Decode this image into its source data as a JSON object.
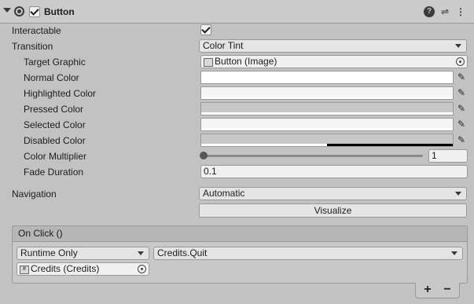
{
  "component": {
    "title": "Button",
    "enabled": true,
    "icons": {
      "help": "help-icon",
      "presets": "presets-icon",
      "menu": "more-vertical-icon",
      "component": "button-component-icon"
    }
  },
  "fields": {
    "interactable": {
      "label": "Interactable",
      "checked": true
    },
    "transition": {
      "label": "Transition",
      "value": "Color Tint"
    },
    "target_graphic": {
      "label": "Target Graphic",
      "value": "Button (Image)"
    },
    "normal_color": {
      "label": "Normal Color",
      "color": "#ffffff",
      "alpha": 1.0
    },
    "highlighted_color": {
      "label": "Highlighted Color",
      "color": "#f5f5f5",
      "alpha": 1.0
    },
    "pressed_color": {
      "label": "Pressed Color",
      "color": "#c8c8c8",
      "alpha": 1.0
    },
    "selected_color": {
      "label": "Selected Color",
      "color": "#f5f5f5",
      "alpha": 1.0
    },
    "disabled_color": {
      "label": "Disabled Color",
      "color": "#c8c8c8",
      "alpha": 0.5
    },
    "color_multiplier": {
      "label": "Color Multiplier",
      "value": "1",
      "fraction": 0.0
    },
    "fade_duration": {
      "label": "Fade Duration",
      "value": "0.1"
    },
    "navigation": {
      "label": "Navigation",
      "value": "Automatic"
    },
    "visualize": {
      "label": "Visualize"
    }
  },
  "on_click": {
    "header": "On Click ()",
    "runtime": "Runtime Only",
    "function": "Credits.Quit",
    "object": "Credits (Credits)",
    "add": "+",
    "remove": "−"
  }
}
